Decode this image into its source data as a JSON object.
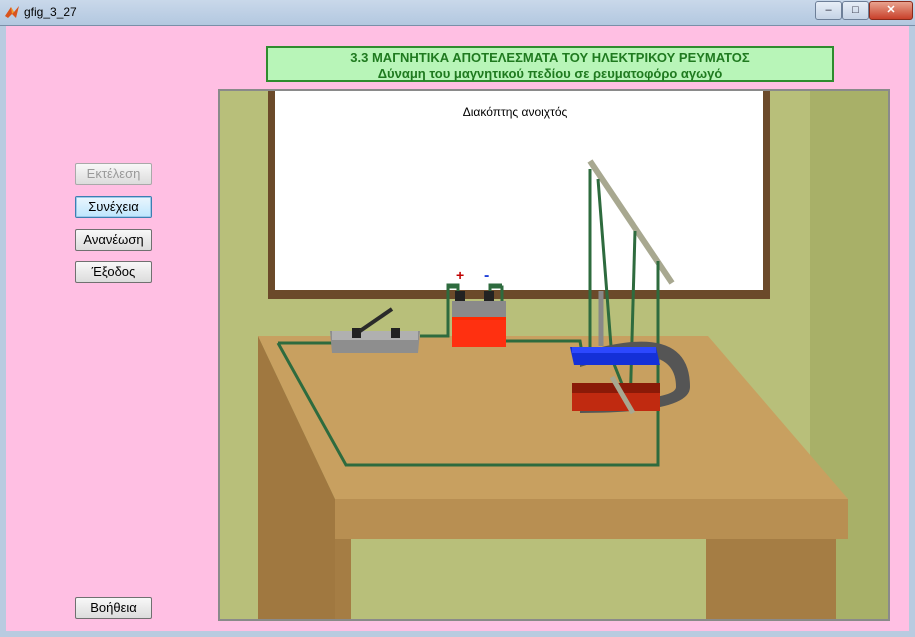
{
  "window": {
    "title": "gfig_3_27",
    "minimize_glyph": "–",
    "maximize_glyph": "□",
    "close_glyph": "✕"
  },
  "header": {
    "line1": "3.3 ΜΑΓΝΗΤΙΚΑ ΑΠΟΤΕΛΕΣΜΑΤΑ ΤΟΥ ΗΛΕΚΤΡΙΚΟΥ ΡΕΥΜΑΤΟΣ",
    "line2": "Δύναμη του μαγνητικού πεδίου σε ρευματοφόρο αγωγό"
  },
  "buttons": {
    "run": "Εκτέλεση",
    "continue": "Συνέχεια",
    "refresh": "Ανανέωση",
    "exit": "Έξοδος",
    "help": "Βοήθεια"
  },
  "scene": {
    "status": "Διακόπτης ανοιχτός",
    "battery_plus": "+",
    "battery_minus": "-"
  },
  "colors": {
    "background": "#ffbfe3",
    "header_bg": "#b8f5b8",
    "header_text": "#1f7a1f",
    "wall": "#b8bf7a",
    "table_top": "#c8a060",
    "wire": "#2e6b3e",
    "magnet_north": "#1430d8",
    "magnet_south": "#c02a10"
  },
  "icons": {
    "app": "matlab-icon"
  }
}
